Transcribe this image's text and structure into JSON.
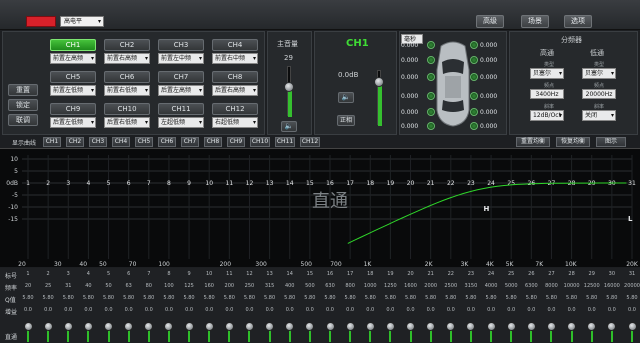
{
  "topbar": {
    "red_button_label": "",
    "device_select_value": "高电平",
    "buttons": [
      "高级",
      "场景",
      "选项"
    ]
  },
  "channels": [
    {
      "label": "CH1",
      "select": "前置左高频",
      "active": true
    },
    {
      "label": "CH2",
      "select": "前置右高频",
      "active": false
    },
    {
      "label": "CH3",
      "select": "前置左中频",
      "active": false
    },
    {
      "label": "CH4",
      "select": "前置右中频",
      "active": false
    },
    {
      "label": "CH5",
      "select": "前置左低频",
      "active": false
    },
    {
      "label": "CH6",
      "select": "前置右低频",
      "active": false
    },
    {
      "label": "CH7",
      "select": "后置左高频",
      "active": false
    },
    {
      "label": "CH8",
      "select": "后置右高频",
      "active": false
    },
    {
      "label": "CH9",
      "select": "后置左低频",
      "active": false
    },
    {
      "label": "CH10",
      "select": "后置右低频",
      "active": false
    },
    {
      "label": "CH11",
      "select": "左超低频",
      "active": false
    },
    {
      "label": "CH12",
      "select": "右超低频",
      "active": false
    }
  ],
  "side_buttons": [
    "重置",
    "锁定",
    "联调"
  ],
  "master": {
    "title": "主音量",
    "value": "29",
    "level": 0.58
  },
  "channel_panel": {
    "title": "CH1",
    "db": "0.0dB",
    "phase_button": "正相",
    "level": 0.78
  },
  "car": {
    "unit_select": "毫秒",
    "speaker_values": [
      "0.000",
      "0.000",
      "0.000",
      "0.000",
      "0.000",
      "0.000",
      "0.000",
      "0.000",
      "0.000",
      "0.000",
      "0.000",
      "0.000"
    ]
  },
  "crossover": {
    "title": "分频器",
    "high_label": "高通",
    "low_label": "低通",
    "type_label": "类型",
    "high_type": "贝塞尔",
    "low_type": "贝塞尔",
    "freq_label": "频点",
    "high_freq": "3400Hz",
    "low_freq": "20000Hz",
    "slope_label": "斜率",
    "high_slope": "12dB/Oct",
    "low_slope": "关闭"
  },
  "curve_tabs": {
    "label": "显示曲线",
    "tabs": [
      "CH1",
      "CH2",
      "CH3",
      "CH4",
      "CH5",
      "CH6",
      "CH7",
      "CH8",
      "CH9",
      "CH10",
      "CH11",
      "CH12"
    ],
    "right_buttons": [
      "重置均衡",
      "恢复均衡",
      "图示"
    ]
  },
  "graph": {
    "y_labels": [
      "10",
      "5",
      "0dB",
      "-5",
      "-10",
      "-15"
    ],
    "x_labels": [
      "20",
      "30",
      "40",
      "50",
      "70",
      "100",
      "200",
      "300",
      "500",
      "700",
      "1K",
      "2K",
      "3K",
      "4K",
      "5K",
      "7K",
      "10K",
      "20K"
    ],
    "band_numbers": [
      "1",
      "2",
      "3",
      "4",
      "5",
      "6",
      "7",
      "8",
      "9",
      "10",
      "11",
      "12",
      "13",
      "14",
      "15",
      "16",
      "17",
      "18",
      "19",
      "20",
      "21",
      "22",
      "23",
      "24",
      "25",
      "26",
      "27",
      "28",
      "29",
      "30",
      "31"
    ],
    "mode_label": "直通",
    "marker_h": "H",
    "marker_l": "L",
    "curve_color": "#2fd62a"
  },
  "table": {
    "row_labels": [
      "标号",
      "频率",
      "Q值",
      "增益"
    ],
    "bottom_label": "直通",
    "index": [
      "1",
      "2",
      "3",
      "4",
      "5",
      "6",
      "7",
      "8",
      "9",
      "10",
      "11",
      "12",
      "13",
      "14",
      "15",
      "16",
      "17",
      "18",
      "19",
      "20",
      "21",
      "22",
      "23",
      "24",
      "25",
      "26",
      "27",
      "28",
      "29",
      "30",
      "31"
    ],
    "freq": [
      "20",
      "25",
      "31",
      "40",
      "50",
      "63",
      "80",
      "100",
      "125",
      "160",
      "200",
      "250",
      "315",
      "400",
      "500",
      "630",
      "800",
      "1000",
      "1250",
      "1600",
      "2000",
      "2500",
      "3150",
      "4000",
      "5000",
      "6300",
      "8000",
      "10000",
      "12500",
      "16000",
      "20000"
    ],
    "q": [
      "5.80",
      "5.80",
      "5.80",
      "5.80",
      "5.80",
      "5.80",
      "5.80",
      "5.80",
      "5.80",
      "5.80",
      "5.80",
      "5.80",
      "5.80",
      "5.80",
      "5.80",
      "5.80",
      "5.80",
      "5.80",
      "5.80",
      "5.80",
      "5.80",
      "5.80",
      "5.80",
      "5.80",
      "5.80",
      "5.80",
      "5.80",
      "5.80",
      "5.80",
      "5.80",
      "5.80"
    ],
    "gain": [
      "0.0",
      "0.0",
      "0.0",
      "0.0",
      "0.0",
      "0.0",
      "0.0",
      "0.0",
      "0.0",
      "0.0",
      "0.0",
      "0.0",
      "0.0",
      "0.0",
      "0.0",
      "0.0",
      "0.0",
      "0.0",
      "0.0",
      "0.0",
      "0.0",
      "0.0",
      "0.0",
      "0.0",
      "0.0",
      "0.0",
      "0.0",
      "0.0",
      "0.0",
      "0.0",
      "0.0"
    ]
  }
}
